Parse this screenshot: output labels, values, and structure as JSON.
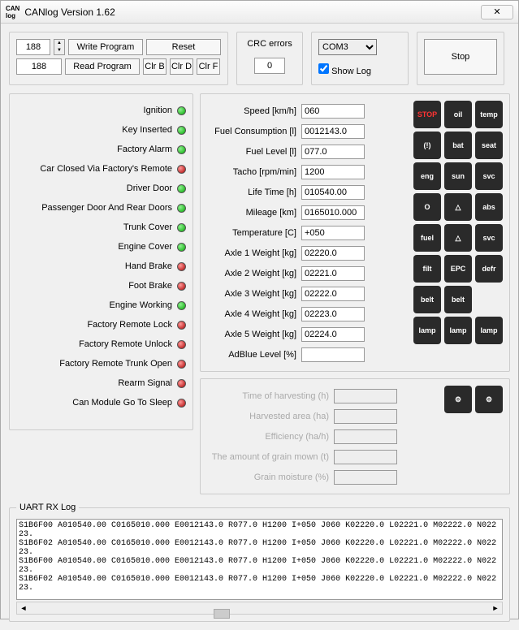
{
  "window": {
    "title": "CANlog Version 1.62",
    "logo": "CAN\nlog"
  },
  "top": {
    "addr1": "188",
    "addr2": "188",
    "write": "Write Program",
    "read": "Read Program",
    "reset": "Reset",
    "clrB": "Clr B",
    "clrD": "Clr D",
    "clrF": "Clr F"
  },
  "crc": {
    "label": "CRC errors",
    "value": "0"
  },
  "com": {
    "port": "COM3",
    "showlog": "Show Log",
    "checked": true
  },
  "stop": "Stop",
  "status": [
    {
      "label": "Ignition",
      "color": "green"
    },
    {
      "label": "Key Inserted",
      "color": "green"
    },
    {
      "label": "Factory Alarm",
      "color": "green"
    },
    {
      "label": "Car Closed Via Factory's Remote",
      "color": "red"
    },
    {
      "label": "Driver Door",
      "color": "green"
    },
    {
      "label": "Passenger Door And Rear Doors",
      "color": "green"
    },
    {
      "label": "Trunk Cover",
      "color": "green"
    },
    {
      "label": "Engine Cover",
      "color": "green"
    },
    {
      "label": "Hand Brake",
      "color": "red"
    },
    {
      "label": "Foot Brake",
      "color": "red"
    },
    {
      "label": "Engine Working",
      "color": "green"
    },
    {
      "label": "Factory Remote Lock",
      "color": "red"
    },
    {
      "label": "Factory Remote Unlock",
      "color": "red"
    },
    {
      "label": "Factory Remote Trunk Open",
      "color": "red"
    },
    {
      "label": "Rearm Signal",
      "color": "red"
    },
    {
      "label": "Can Module Go To Sleep",
      "color": "red"
    }
  ],
  "values": [
    {
      "label": "Speed [km/h]",
      "value": "060"
    },
    {
      "label": "Fuel Consumption [l]",
      "value": "0012143.0"
    },
    {
      "label": "Fuel Level [l]",
      "value": "077.0"
    },
    {
      "label": "Tacho [rpm/min]",
      "value": "1200"
    },
    {
      "label": "Life Time [h]",
      "value": "010540.00"
    },
    {
      "label": "Mileage [km]",
      "value": "0165010.000"
    },
    {
      "label": "Temperature [C]",
      "value": "+050"
    },
    {
      "label": "Axle 1 Weight [kg]",
      "value": "02220.0"
    },
    {
      "label": "Axle 2 Weight [kg]",
      "value": "02221.0"
    },
    {
      "label": "Axle 3 Weight [kg]",
      "value": "02222.0"
    },
    {
      "label": "Axle 4 Weight [kg]",
      "value": "02223.0"
    },
    {
      "label": "Axle 5 Weight [kg]",
      "value": "02224.0"
    },
    {
      "label": "AdBlue Level [%]",
      "value": ""
    }
  ],
  "agri": [
    {
      "label": "Time of harvesting (h)"
    },
    {
      "label": "Harvested area (ha)"
    },
    {
      "label": "Efficiency (ha/h)"
    },
    {
      "label": "The amount of grain mown (t)"
    },
    {
      "label": "Grain moisture (%)"
    }
  ],
  "icons": [
    "STOP",
    "oil",
    "temp",
    "(!)",
    "bat",
    "seat",
    "eng",
    "sun",
    "svc",
    "O",
    "△",
    "abs",
    "fuel",
    "△",
    "svc",
    "filt",
    "EPC",
    "defr",
    "belt",
    "belt",
    "",
    "lamp",
    "lamp",
    "lamp"
  ],
  "agricons": [
    "gear",
    "spray"
  ],
  "uart": {
    "title": "UART RX Log",
    "lines": [
      "S1B6F00 A010540.00 C0165010.000 E0012143.0 R077.0 H1200 I+050 J060 K02220.0 L02221.0 M02222.0 N02223.",
      "S1B6F02 A010540.00 C0165010.000 E0012143.0 R077.0 H1200 I+050 J060 K02220.0 L02221.0 M02222.0 N02223.",
      "S1B6F00 A010540.00 C0165010.000 E0012143.0 R077.0 H1200 I+050 J060 K02220.0 L02221.0 M02222.0 N02223.",
      "S1B6F02 A010540.00 C0165010.000 E0012143.0 R077.0 H1200 I+050 J060 K02220.0 L02221.0 M02222.0 N02223."
    ]
  }
}
